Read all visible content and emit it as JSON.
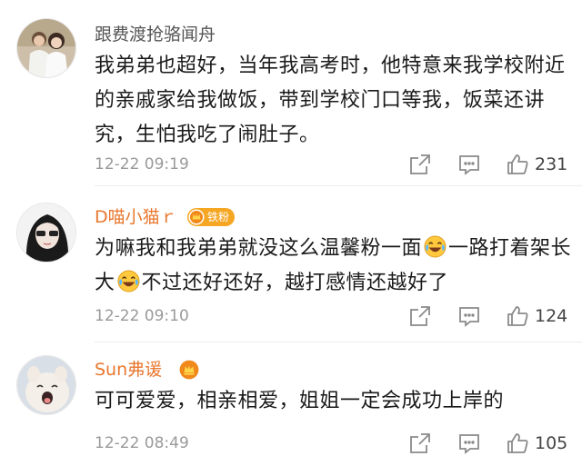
{
  "comments": [
    {
      "username": "跟费渡抢骆闻舟",
      "text": "我弟弟也超好，当年我高考时，他特意来我学校附近的亲戚家给我做饭，带到学校门口等我，饭菜还讲究，生怕我吃了闹肚子。",
      "time": "12-22 09:19",
      "likes": "231"
    },
    {
      "username": "D喵小猫ｒ",
      "badge": "铁粉",
      "text_parts": [
        "为嘛我和我弟弟就没这么温馨粉一面",
        "一路打着架长大",
        "不过还好还好，越打感情还越好了"
      ],
      "time": "12-22 09:10",
      "likes": "124"
    },
    {
      "username": "Sun弗谖",
      "text": "可可爱爱，相亲相爱，姐姐一定会成功上岸的",
      "time": "12-22 08:49",
      "likes": "105"
    }
  ],
  "icons": {
    "share": "share-icon",
    "comment": "comment-icon",
    "like": "thumbs-up-icon",
    "laugh": "laughing-crying-emoji",
    "vip": "vip-crown-icon"
  },
  "colors": {
    "username_orange": "#e8772e",
    "username_gray": "#555555",
    "badge": "#f5a623",
    "timestamp": "#9a9a9a"
  }
}
